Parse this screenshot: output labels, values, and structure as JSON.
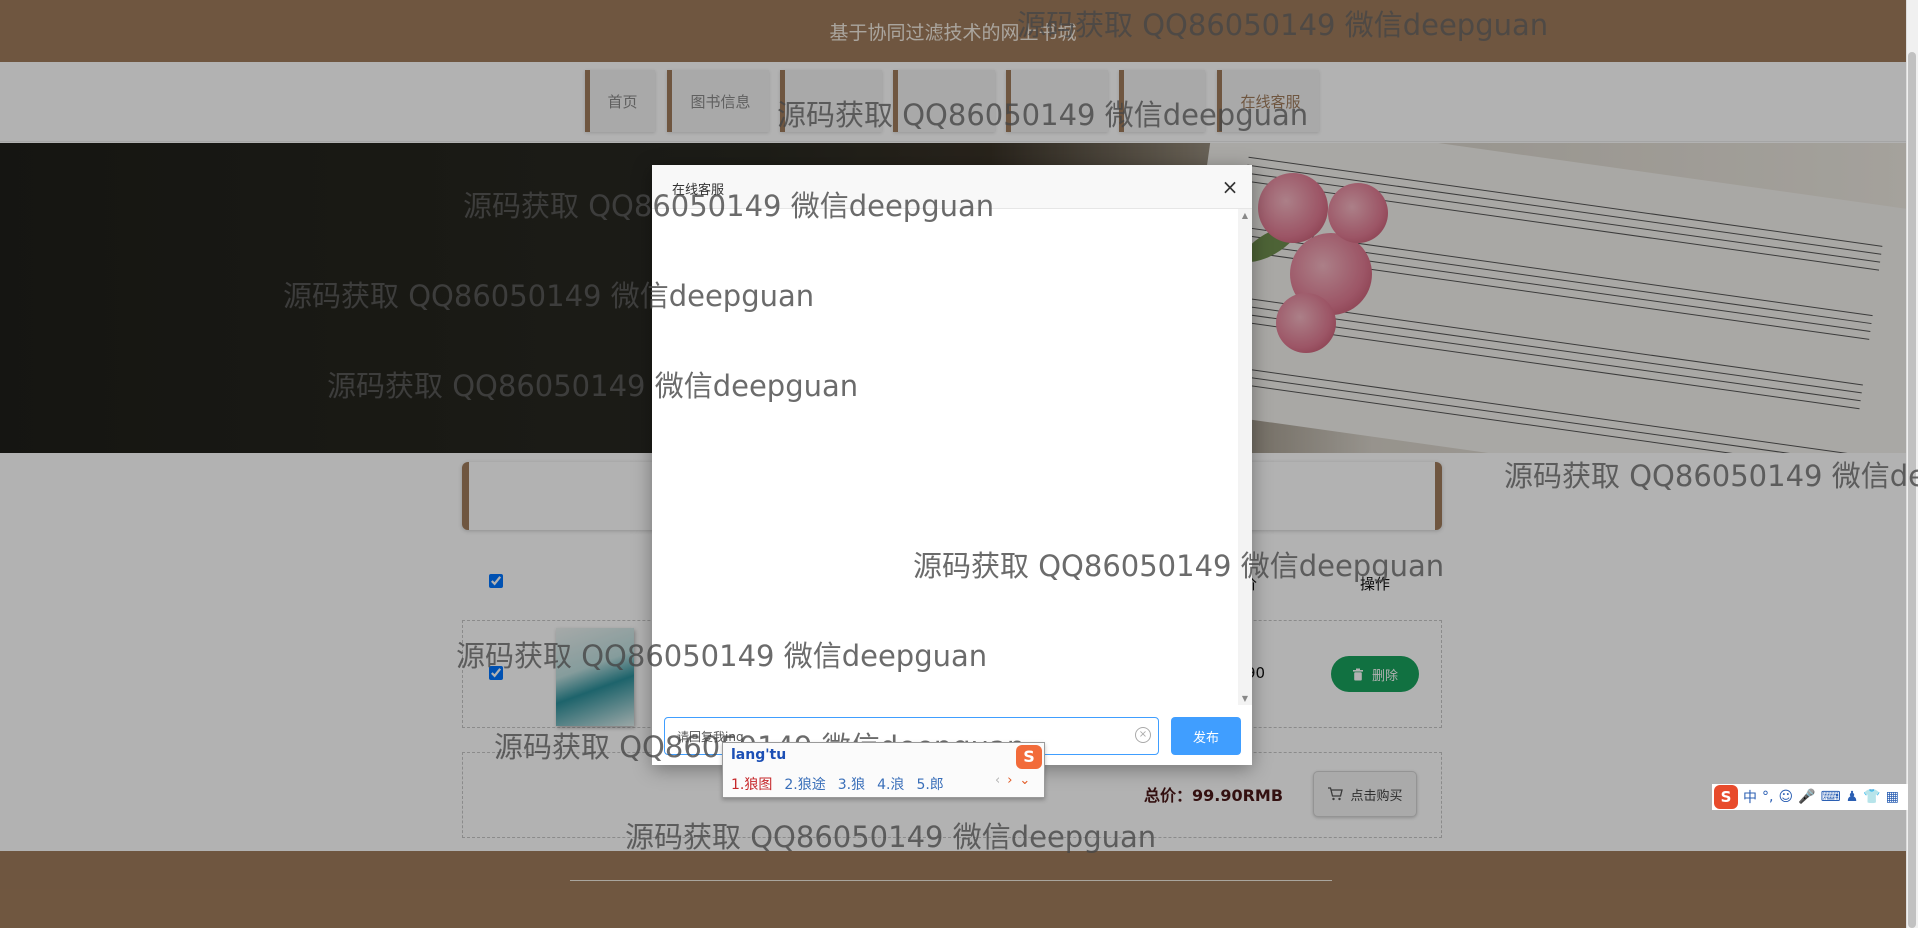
{
  "site": {
    "title": "基于协同过滤技术的网上书城"
  },
  "nav": {
    "items": [
      {
        "label": "首页"
      },
      {
        "label": "图书信息"
      },
      {
        "label": ""
      },
      {
        "label": ""
      },
      {
        "label": ""
      },
      {
        "label": ""
      },
      {
        "label": "在线客服"
      }
    ]
  },
  "cart": {
    "header": {
      "price_label": "价",
      "action_label": "操作"
    },
    "row": {
      "price": "90",
      "delete_label": "删除"
    },
    "total": {
      "label": "总价：99.90RMB",
      "buy_label": "点击购买"
    }
  },
  "chat_modal": {
    "title": "在线客服",
    "close_glyph": "×",
    "input_value": "请回复我ing",
    "send_label": "发布"
  },
  "ime": {
    "pinyin": "lang'tu",
    "logo": "S",
    "candidates": [
      "1.狼图",
      "2.狼途",
      "3.狼",
      "4.浪",
      "5.郎"
    ],
    "status_items": [
      "中",
      "°,",
      "☺",
      "🎤",
      "⌨",
      "♟",
      "👕",
      "▦"
    ]
  },
  "watermark": {
    "text": "源码获取 QQ86050149 微信deepguan"
  },
  "icons": {
    "close": "close-icon",
    "trash": "trash-icon",
    "cart": "cart-icon",
    "clear": "clear-icon"
  },
  "colors": {
    "brand_brown": "#a07c5c",
    "delete_green": "#19a25d",
    "send_blue": "#409eff",
    "total_text": "#4a1818"
  }
}
